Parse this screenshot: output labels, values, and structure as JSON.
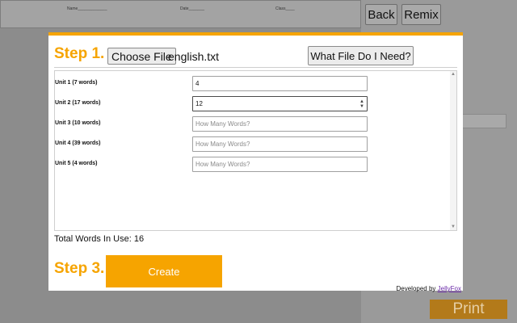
{
  "background": {
    "worksheet_fields": [
      "Name_____________",
      "Date_______",
      "Class____"
    ],
    "back_label": "Back",
    "remix_label": "Remix",
    "print_label": "Print"
  },
  "modal": {
    "step1_label": "Step 1.",
    "choose_file_label": "Choose File",
    "file_name": "english.txt",
    "help_label": "What File Do I Need?",
    "units": [
      {
        "label": "Unit 1 (7 words)",
        "value": "4",
        "placeholder": "How Many Words?"
      },
      {
        "label": "Unit 2 (17 words)",
        "value": "12",
        "placeholder": "How Many Words?"
      },
      {
        "label": "Unit 3 (10 words)",
        "value": "",
        "placeholder": "How Many Words?"
      },
      {
        "label": "Unit 4 (39 words)",
        "value": "",
        "placeholder": "How Many Words?"
      },
      {
        "label": "Unit 5 (4 words)",
        "value": "",
        "placeholder": "How Many Words?"
      }
    ],
    "total_text": "Total Words In Use: 16",
    "step3_label": "Step 3.",
    "create_label": "Create",
    "credit_prefix": "Developed by ",
    "credit_link": "JellyFox"
  },
  "colors": {
    "accent": "#f6a400",
    "link": "#6a2aa8",
    "overlay": "#9a9a9a"
  },
  "icons": {
    "stepper": "up-down-arrows",
    "scroll": "scroll-arrows"
  }
}
